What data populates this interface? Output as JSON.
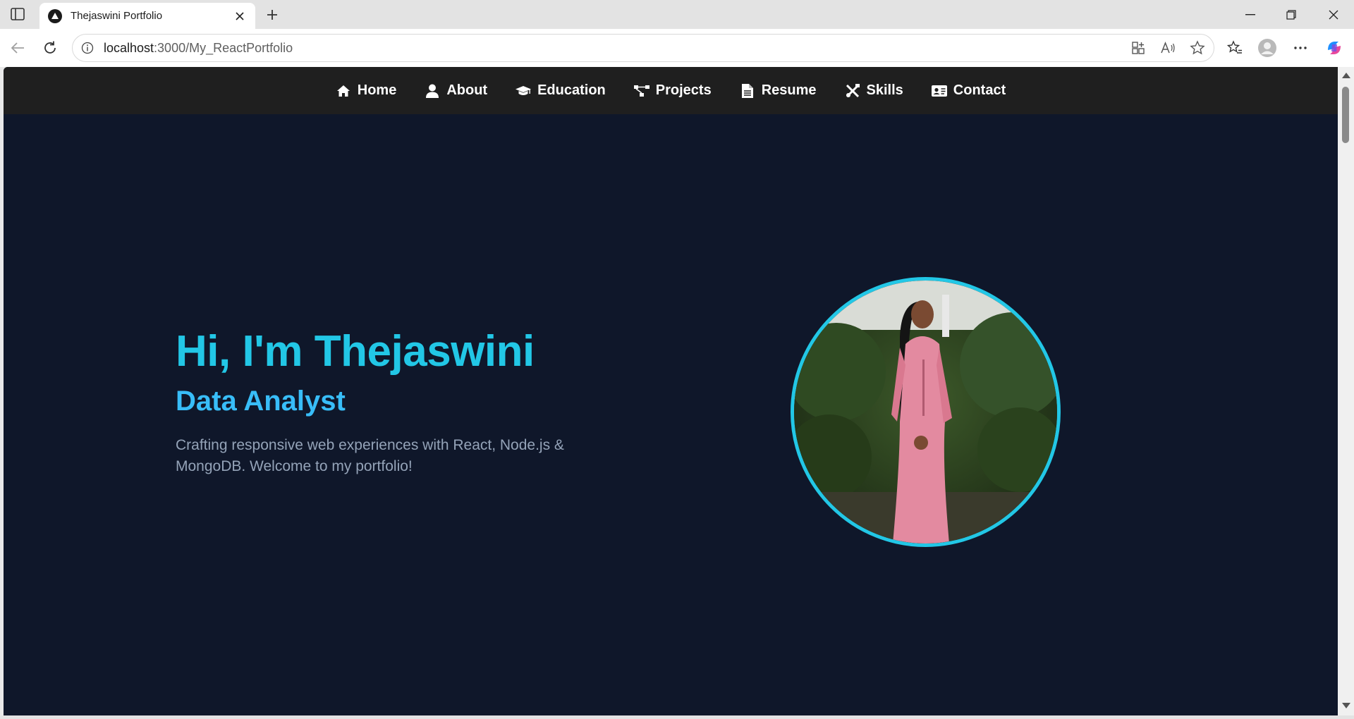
{
  "browser": {
    "tab_title": "Thejaswini Portfolio",
    "url_host": "localhost",
    "url_rest": ":3000/My_ReactPortfolio"
  },
  "nav": {
    "items": [
      {
        "label": "Home",
        "icon": "home-icon"
      },
      {
        "label": "About",
        "icon": "user-icon"
      },
      {
        "label": "Education",
        "icon": "graduation-cap-icon"
      },
      {
        "label": "Projects",
        "icon": "project-diagram-icon"
      },
      {
        "label": "Resume",
        "icon": "file-icon"
      },
      {
        "label": "Skills",
        "icon": "tools-icon"
      },
      {
        "label": "Contact",
        "icon": "address-card-icon"
      }
    ]
  },
  "hero": {
    "title": "Hi, I'm Thejaswini",
    "subtitle": "Data Analyst",
    "description": "Crafting responsive web experiences with React, Node.js & MongoDB. Welcome to my portfolio!"
  },
  "colors": {
    "page_bg": "#0f172a",
    "navbar_bg": "#1f1f1f",
    "accent": "#22c7e6",
    "subtitle": "#38bdf8",
    "muted_text": "#94a3b8"
  }
}
